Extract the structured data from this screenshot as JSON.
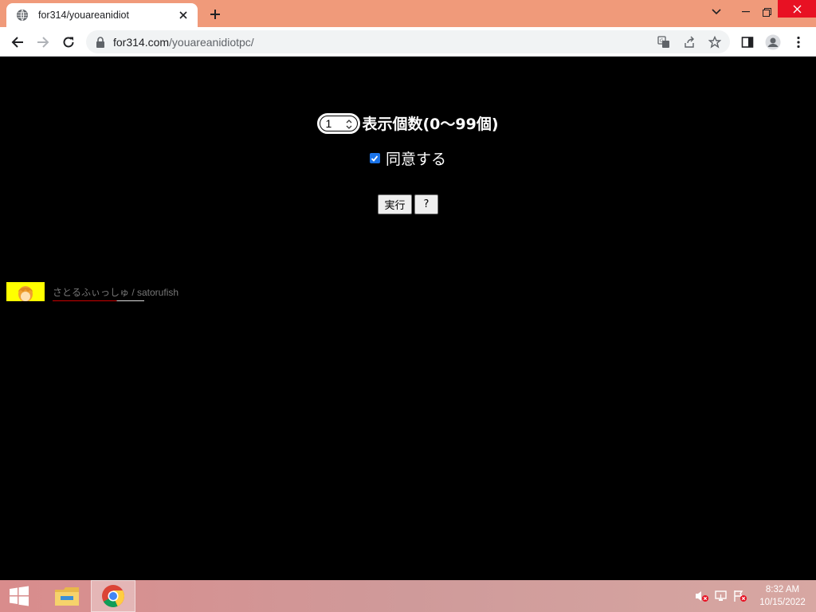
{
  "browser": {
    "tab_title": "for314/youareanidiot",
    "url_host": "for314.com",
    "url_path": "/youareanidiotpc/"
  },
  "page": {
    "count_value": "1",
    "count_label": "表示個数(0〜99個)",
    "agree_label": "同意する",
    "agree_checked": true,
    "run_button": "実行",
    "help_button": "?",
    "credit_name": "さとるふぃっしゅ / satorufish"
  },
  "taskbar": {
    "time": "8:32 AM",
    "date": "10/15/2022"
  },
  "colors": {
    "titlebar": "#f09a7a",
    "page_bg": "#000000",
    "checkbox": "#1a73e8",
    "close_button": "#e81123"
  }
}
